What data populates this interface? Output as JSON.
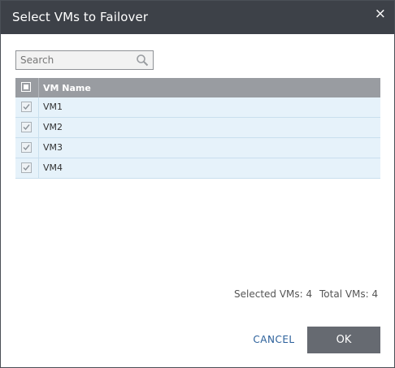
{
  "dialog": {
    "title": "Select VMs to Failover",
    "close_label": "×"
  },
  "search": {
    "placeholder": "Search",
    "value": ""
  },
  "grid": {
    "column_header": "VM Name",
    "rows": [
      {
        "name": "VM1",
        "checked": true
      },
      {
        "name": "VM2",
        "checked": true
      },
      {
        "name": "VM3",
        "checked": true
      },
      {
        "name": "VM4",
        "checked": true
      }
    ]
  },
  "footer": {
    "selected_text": "Selected VMs: 4",
    "total_text": "Total VMs: 4",
    "cancel_label": "CANCEL",
    "ok_label": "OK"
  },
  "colors": {
    "titlebar": "#3d4148",
    "header": "#999ca1",
    "row_bg": "#e6f2fa",
    "ok_button": "#666a71",
    "link": "#2a5f9a"
  }
}
